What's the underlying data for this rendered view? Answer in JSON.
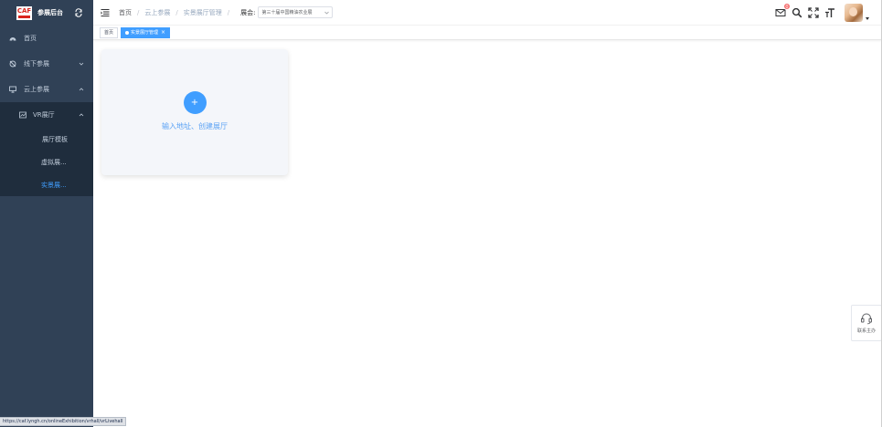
{
  "brand": {
    "logo_text": "CAF",
    "title": "参展后台"
  },
  "sidebar": {
    "items": [
      {
        "label": "首页",
        "icon": "dashboard-icon"
      },
      {
        "label": "线下参展",
        "icon": "offline-icon"
      },
      {
        "label": "云上参展",
        "icon": "monitor-icon"
      }
    ],
    "vr": {
      "label": "VR展厅",
      "icon": "chart-icon"
    },
    "vr_children": [
      {
        "label": "展厅模板"
      },
      {
        "label": "虚拟展..."
      },
      {
        "label": "实景展..."
      }
    ]
  },
  "header": {
    "breadcrumb": [
      "首页",
      "云上参展",
      "实景展厅管理"
    ],
    "exhibit_label": "展会:",
    "exhibit_value": "第三十届中国精油农业展",
    "notification_count": "0"
  },
  "tags": [
    {
      "label": "首页"
    },
    {
      "label": "实景展厅管理"
    }
  ],
  "content": {
    "plus_symbol": "+",
    "create_text": "输入地址、创建展厅"
  },
  "contact": {
    "label": "联系主办"
  },
  "status_url": "https://caf.lyngh.cn/onlineExhibition/vrhall/vrLivehall",
  "colors": {
    "sidebar_bg": "#304156",
    "accent": "#409eff",
    "badge": "#f56c6c"
  }
}
